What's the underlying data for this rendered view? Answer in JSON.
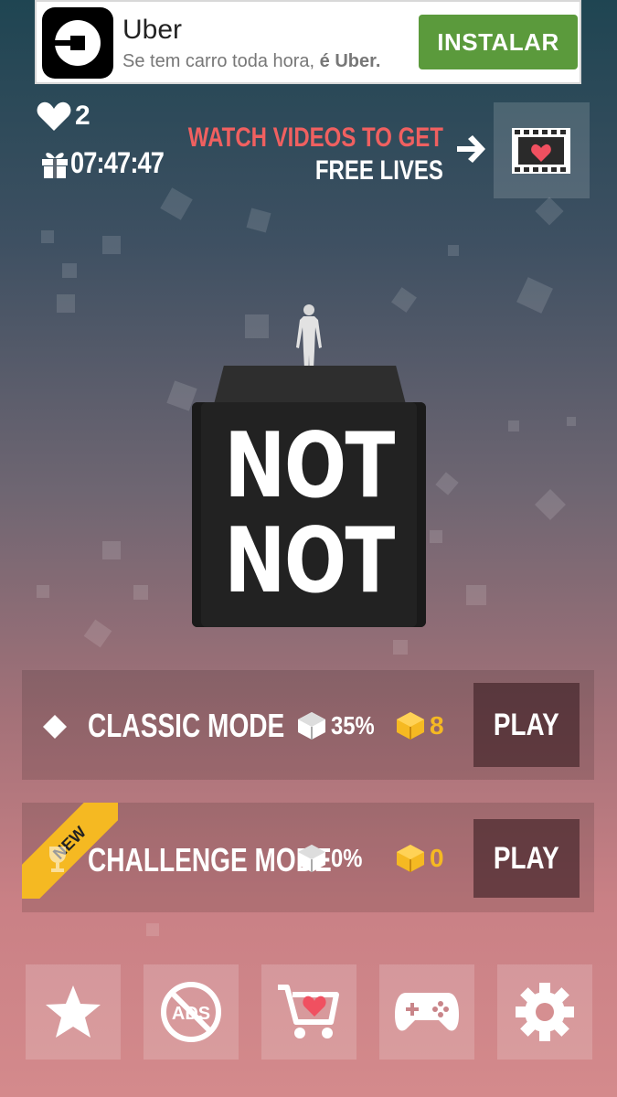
{
  "ad": {
    "title": "Uber",
    "subtitle_prefix": "Se tem carro toda hora, ",
    "subtitle_bold": "é Uber.",
    "install_label": "INSTALAR"
  },
  "hud": {
    "lives": "2",
    "timer": "07:47:47",
    "watch_line1": "WATCH VIDEOS TO GET",
    "watch_line2": "FREE LIVES"
  },
  "logo": {
    "line1": "NOT",
    "line2": "NOT"
  },
  "modes": [
    {
      "label": "CLASSIC MODE",
      "progress": "35%",
      "gems": "8",
      "play_label": "PLAY"
    },
    {
      "label": "CHALLENGE MODE",
      "badge": "NEW",
      "progress": "0%",
      "gems": "0",
      "play_label": "PLAY"
    }
  ],
  "bottom_bar": [
    "star-icon",
    "no-ads-icon",
    "shop-cart-icon",
    "gamepad-icon",
    "gear-icon"
  ],
  "bottom_labels": {
    "no_ads": "ADS"
  },
  "colors": {
    "accent_red": "#f06060",
    "gem_gold": "#f5b922",
    "ad_button": "#5b9a3c"
  }
}
